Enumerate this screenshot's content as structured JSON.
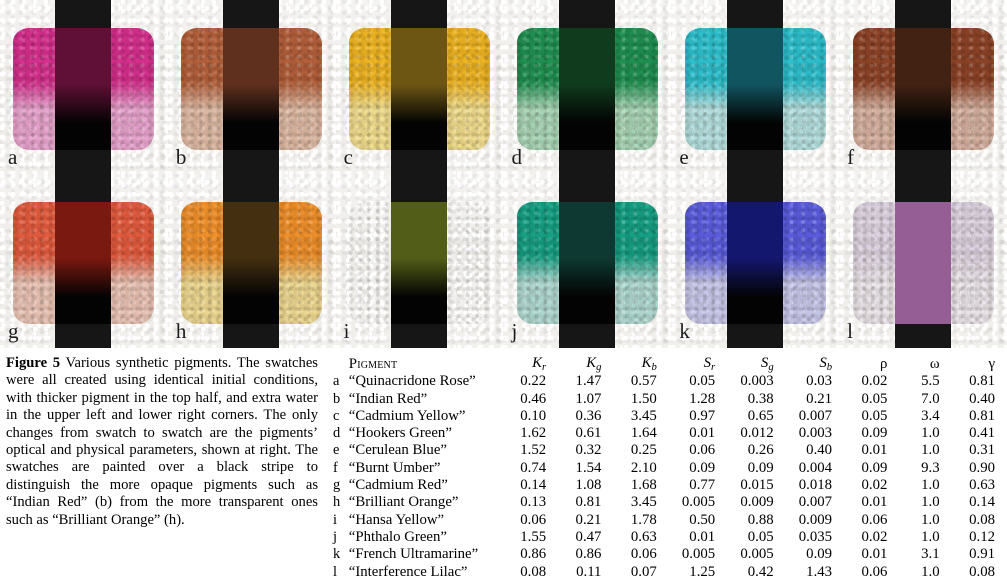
{
  "figure": {
    "label": "Figure 5",
    "caption_text": " Various synthetic pigments. The swatches were all created using identical initial conditions, with thicker pigment in the top half, and extra water in the upper left and lower right corners. The only changes from swatch to swatch are the pigments’ optical and physical parameters, shown at right. The swatches are painted over a black stripe to distinguish the more opaque pigments such as “Indian Red” (b) from the more transparent ones such as “Brilliant Orange” (h).",
    "stripe_color": "#161616",
    "paper_color": "#eeece8"
  },
  "swatches": [
    {
      "key": "a",
      "name": "Quinacridone Rose",
      "thick": "#d62f8f",
      "thin": "#e6a3cf",
      "stripe": "#6d0f3c"
    },
    {
      "key": "b",
      "name": "Indian Red",
      "thick": "#b4603a",
      "thin": "#dcb9a4",
      "stripe": "#6d3520"
    },
    {
      "key": "c",
      "name": "Cadmium Yellow",
      "thick": "#efb522",
      "thin": "#f0dd8e",
      "stripe": "#7d6213"
    },
    {
      "key": "d",
      "name": "Hookers Green",
      "thick": "#1f9152",
      "thin": "#a7d4b6",
      "stripe": "#10421f"
    },
    {
      "key": "e",
      "name": "Cerulean Blue",
      "thick": "#2cc0cf",
      "thin": "#b3dedf",
      "stripe": "#11606e"
    },
    {
      "key": "f",
      "name": "Burnt Umber",
      "thick": "#8d4326",
      "thin": "#d4b0a0",
      "stripe": "#4a2513"
    },
    {
      "key": "g",
      "name": "Cadmium Red",
      "thick": "#e35b3e",
      "thin": "#e8c3b6",
      "stripe": "#8c1a10"
    },
    {
      "key": "h",
      "name": "Brilliant Orange",
      "thick": "#f0902a",
      "thin": "#ecd791",
      "stripe": "#4d3410"
    },
    {
      "key": "i",
      "name": "Hansa Yellow",
      "thick": "#eed martinez",
      "thin": "#ece2ad",
      "stripe": "#5d6a18"
    },
    {
      "key": "j",
      "name": "Phthalo Green",
      "thick": "#15a085",
      "thin": "#aed8d2",
      "stripe": "#0d3f37"
    },
    {
      "key": "k",
      "name": "French Ultramarine",
      "thick": "#5a5ce0",
      "thin": "#c6c6ea",
      "stripe": "#14187e"
    },
    {
      "key": "l",
      "name": "Interference Lilac",
      "thick": "#ddd3e2",
      "thin": "#e9e4ea",
      "stripe": "#ab6aab"
    }
  ],
  "table": {
    "headers": {
      "pigment": "Pigment",
      "kr": "K",
      "kr_sub": "r",
      "kg": "K",
      "kg_sub": "g",
      "kb": "K",
      "kb_sub": "b",
      "sr": "S",
      "sr_sub": "r",
      "sg": "S",
      "sg_sub": "g",
      "sb": "S",
      "sb_sub": "b",
      "rho": "ρ",
      "omega": "ω",
      "gamma": "γ"
    },
    "rows": [
      {
        "key": "a",
        "name": "“Quinacridone Rose”",
        "Kr": "0.22",
        "Kg": "1.47",
        "Kb": "0.57",
        "Sr": "0.05",
        "Sg": "0.003",
        "Sb": "0.03",
        "rho": "0.02",
        "omega": "5.5",
        "gamma": "0.81"
      },
      {
        "key": "b",
        "name": "“Indian Red”",
        "Kr": "0.46",
        "Kg": "1.07",
        "Kb": "1.50",
        "Sr": "1.28",
        "Sg": "0.38",
        "Sb": "0.21",
        "rho": "0.05",
        "omega": "7.0",
        "gamma": "0.40"
      },
      {
        "key": "c",
        "name": "“Cadmium Yellow”",
        "Kr": "0.10",
        "Kg": "0.36",
        "Kb": "3.45",
        "Sr": "0.97",
        "Sg": "0.65",
        "Sb": "0.007",
        "rho": "0.05",
        "omega": "3.4",
        "gamma": "0.81"
      },
      {
        "key": "d",
        "name": "“Hookers Green”",
        "Kr": "1.62",
        "Kg": "0.61",
        "Kb": "1.64",
        "Sr": "0.01",
        "Sg": "0.012",
        "Sb": "0.003",
        "rho": "0.09",
        "omega": "1.0",
        "gamma": "0.41"
      },
      {
        "key": "e",
        "name": "“Cerulean Blue”",
        "Kr": "1.52",
        "Kg": "0.32",
        "Kb": "0.25",
        "Sr": "0.06",
        "Sg": "0.26",
        "Sb": "0.40",
        "rho": "0.01",
        "omega": "1.0",
        "gamma": "0.31"
      },
      {
        "key": "f",
        "name": "“Burnt Umber”",
        "Kr": "0.74",
        "Kg": "1.54",
        "Kb": "2.10",
        "Sr": "0.09",
        "Sg": "0.09",
        "Sb": "0.004",
        "rho": "0.09",
        "omega": "9.3",
        "gamma": "0.90"
      },
      {
        "key": "g",
        "name": "“Cadmium Red”",
        "Kr": "0.14",
        "Kg": "1.08",
        "Kb": "1.68",
        "Sr": "0.77",
        "Sg": "0.015",
        "Sb": "0.018",
        "rho": "0.02",
        "omega": "1.0",
        "gamma": "0.63"
      },
      {
        "key": "h",
        "name": "“Brilliant Orange”",
        "Kr": "0.13",
        "Kg": "0.81",
        "Kb": "3.45",
        "Sr": "0.005",
        "Sg": "0.009",
        "Sb": "0.007",
        "rho": "0.01",
        "omega": "1.0",
        "gamma": "0.14"
      },
      {
        "key": "i",
        "name": "“Hansa Yellow”",
        "Kr": "0.06",
        "Kg": "0.21",
        "Kb": "1.78",
        "Sr": "0.50",
        "Sg": "0.88",
        "Sb": "0.009",
        "rho": "0.06",
        "omega": "1.0",
        "gamma": "0.08"
      },
      {
        "key": "j",
        "name": "“Phthalo Green”",
        "Kr": "1.55",
        "Kg": "0.47",
        "Kb": "0.63",
        "Sr": "0.01",
        "Sg": "0.05",
        "Sb": "0.035",
        "rho": "0.02",
        "omega": "1.0",
        "gamma": "0.12"
      },
      {
        "key": "k",
        "name": "“French Ultramarine”",
        "Kr": "0.86",
        "Kg": "0.86",
        "Kb": "0.06",
        "Sr": "0.005",
        "Sg": "0.005",
        "Sb": "0.09",
        "rho": "0.01",
        "omega": "3.1",
        "gamma": "0.91"
      },
      {
        "key": "l",
        "name": "“Interference Lilac”",
        "Kr": "0.08",
        "Kg": "0.11",
        "Kb": "0.07",
        "Sr": "1.25",
        "Sg": "0.42",
        "Sb": "1.43",
        "rho": "0.06",
        "omega": "1.0",
        "gamma": "0.08"
      }
    ]
  }
}
